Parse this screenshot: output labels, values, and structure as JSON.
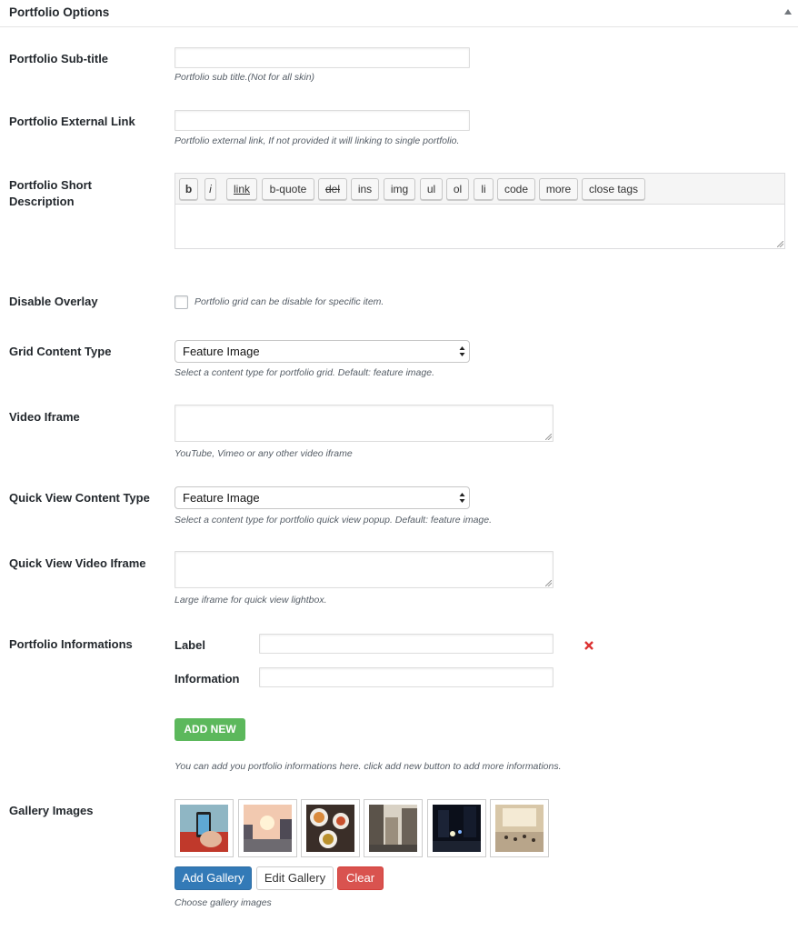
{
  "header": {
    "title": "Portfolio Options",
    "toggle_icon": "arrow-up-icon"
  },
  "subtitle": {
    "label": "Portfolio Sub-title",
    "value": "",
    "description": "Portfolio sub title.(Not for all skin)"
  },
  "external_link": {
    "label": "Portfolio External Link",
    "value": "",
    "description": "Portfolio external link, If not provided it will linking to single portfolio."
  },
  "short_description": {
    "label": "Portfolio Short Description",
    "value": "",
    "toolbar": [
      "b",
      "i",
      "link",
      "b-quote",
      "del",
      "ins",
      "img",
      "ul",
      "ol",
      "li",
      "code",
      "more",
      "close tags"
    ]
  },
  "disable_overlay": {
    "label": "Disable Overlay",
    "checked": false,
    "description": "Portfolio grid can be disable for specific item."
  },
  "grid_content_type": {
    "label": "Grid Content Type",
    "selected": "Feature Image",
    "description": "Select a content type for portfolio grid. Default: feature image."
  },
  "video_iframe": {
    "label": "Video Iframe",
    "value": "",
    "description": "YouTube, Vimeo or any other video iframe"
  },
  "quick_view_content_type": {
    "label": "Quick View Content Type",
    "selected": "Feature Image",
    "description": "Select a content type for portfolio quick view popup. Default: feature image."
  },
  "quick_view_video_iframe": {
    "label": "Quick View Video Iframe",
    "value": "",
    "description": "Large iframe for quick view lightbox."
  },
  "informations": {
    "label": "Portfolio Informations",
    "label_field": "Label",
    "information_field": "Information",
    "label_value": "",
    "information_value": "",
    "add_new": "ADD NEW",
    "description": "You can add you portfolio informations here. click add new button to add more informations.",
    "remove_icon": "close-icon",
    "remove_color": "#dc3232"
  },
  "gallery": {
    "label": "Gallery Images",
    "images": [
      "phone-in-hand",
      "city-bridge-sunset",
      "food-platter",
      "city-street-buildings",
      "night-street",
      "train-station-crowd"
    ],
    "add_label": "Add Gallery",
    "edit_label": "Edit Gallery",
    "clear_label": "Clear",
    "description": "Choose gallery images"
  },
  "colors": {
    "add_new_green": "#5cb85c",
    "primary_blue": "#337ab7",
    "danger_red": "#d9534f"
  }
}
